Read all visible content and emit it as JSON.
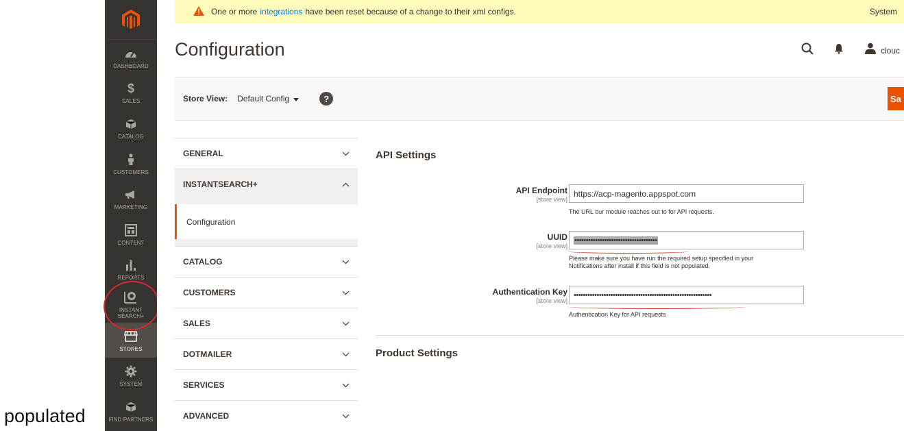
{
  "caption": "populated",
  "sidebar": {
    "items": [
      {
        "label": "DASHBOARD",
        "icon": "dashboard-icon"
      },
      {
        "label": "$",
        "sub": "SALES",
        "icon": "dollar-icon"
      },
      {
        "label": "CATALOG",
        "icon": "cube-icon"
      },
      {
        "label": "CUSTOMERS",
        "icon": "person-icon"
      },
      {
        "label": "MARKETING",
        "icon": "megaphone-icon"
      },
      {
        "label": "CONTENT",
        "icon": "layout-icon"
      },
      {
        "label": "REPORTS",
        "icon": "bar-chart-icon"
      },
      {
        "label": "INSTANT SEARCH+",
        "icon": "instant-search-icon"
      },
      {
        "label": "STORES",
        "icon": "storefront-icon"
      },
      {
        "label": "SYSTEM",
        "icon": "gear-icon"
      },
      {
        "label": "FIND PARTNERS",
        "icon": "partners-icon"
      }
    ]
  },
  "notice": {
    "before": "One or more",
    "link": "integrations",
    "after": "have been reset because of a change to their xml configs.",
    "right": "System"
  },
  "header": {
    "title": "Configuration",
    "user": "clouc"
  },
  "store_bar": {
    "label": "Store View:",
    "value": "Default Config",
    "help": "?",
    "save": "Sa"
  },
  "config_nav": {
    "items": [
      {
        "label": "GENERAL"
      },
      {
        "label": "INSTANTSEARCH+"
      },
      {
        "label": "CATALOG"
      },
      {
        "label": "CUSTOMERS"
      },
      {
        "label": "SALES"
      },
      {
        "label": "DOTMAILER"
      },
      {
        "label": "SERVICES"
      },
      {
        "label": "ADVANCED"
      }
    ],
    "sub": "Configuration"
  },
  "settings": {
    "api_title": "API Settings",
    "product_title": "Product Settings",
    "scope": "[store view]",
    "endpoint": {
      "label": "API Endpoint",
      "value": "https://acp-magento.appspot.com",
      "note": "The URL our module reaches out to for API requests."
    },
    "uuid": {
      "label": "UUID",
      "value": "••••••••••••••••••••••••••••••••••••",
      "note1": "Please make sure you have run the required setup specified in your",
      "note2": "Notifications after install if this field is not populated."
    },
    "auth": {
      "label": "Authentication Key",
      "value": "••••••••••••••••••••••••••••••••••••••••••••••••••••••••••••",
      "note": "Authentication Key for API requests"
    }
  },
  "colors": {
    "accent": "#eb5202",
    "sidebar": "#373330",
    "annotation": "#d32c2c",
    "notice_bg": "#fffbbb"
  }
}
